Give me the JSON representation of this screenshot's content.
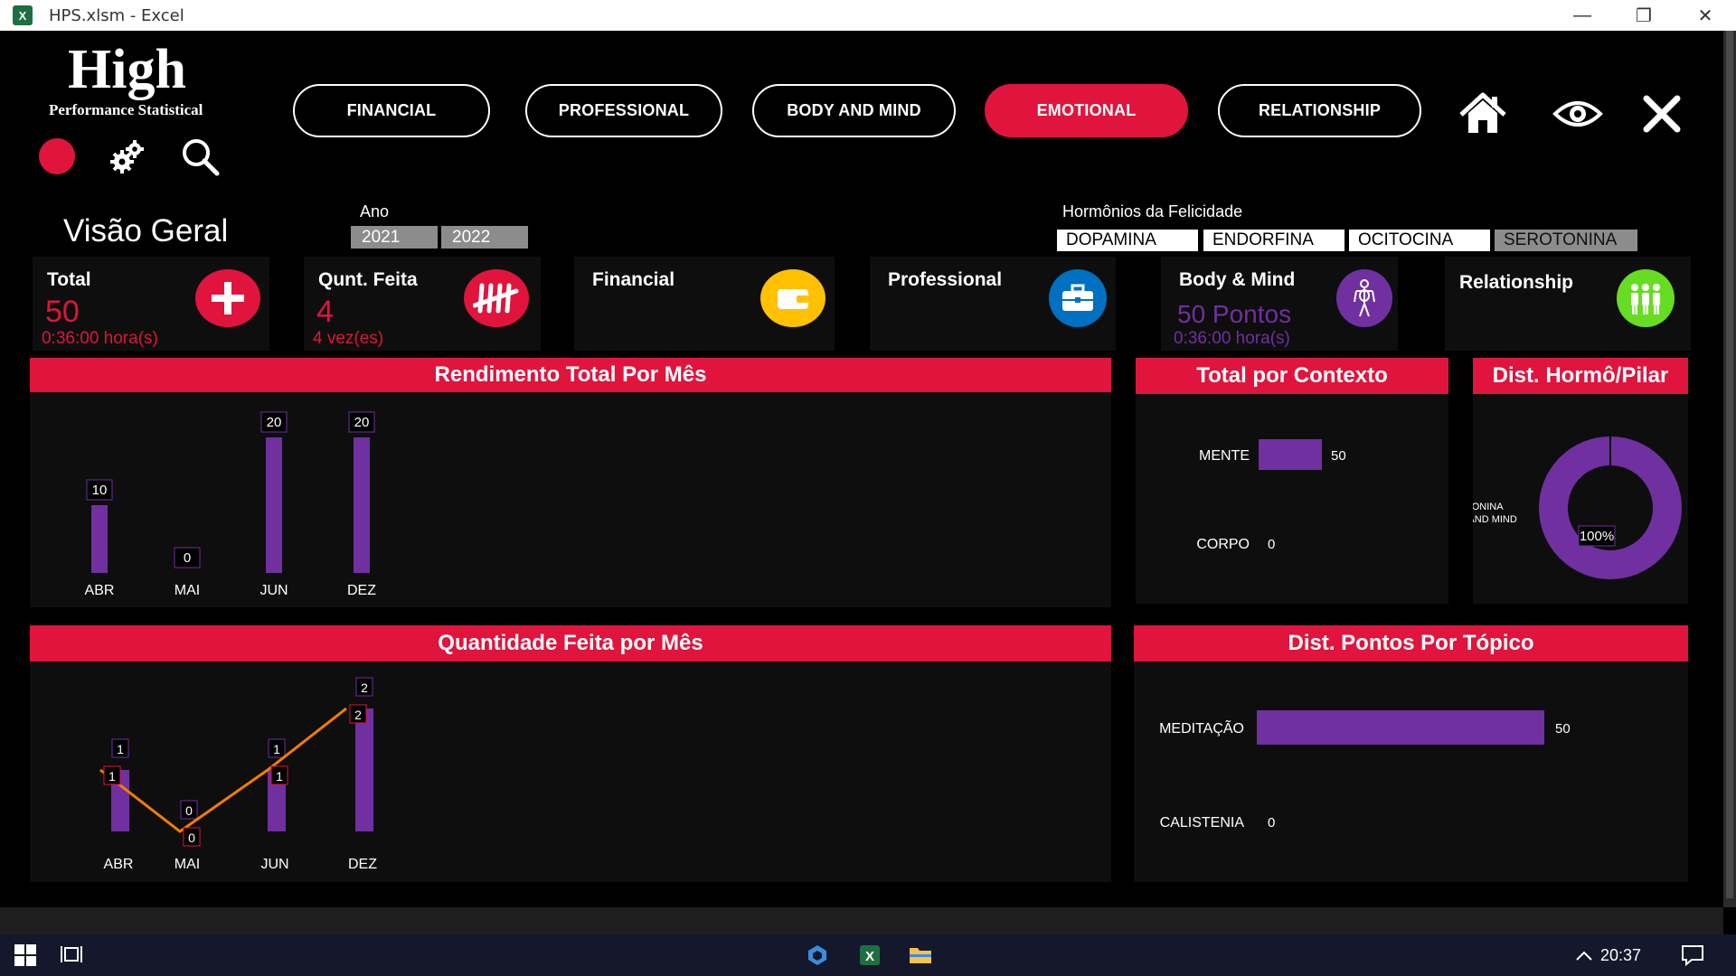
{
  "window": {
    "title": "HPS.xlsm  -  Excel",
    "app_icon_letter": "X"
  },
  "logo": {
    "title": "High",
    "subtitle": "Performance Statistical"
  },
  "nav": {
    "buttons": [
      {
        "label": "FINANCIAL",
        "active": false
      },
      {
        "label": "PROFESSIONAL",
        "active": false
      },
      {
        "label": "BODY AND MIND",
        "active": false
      },
      {
        "label": "EMOTIONAL",
        "active": true
      },
      {
        "label": "RELATIONSHIP",
        "active": false
      }
    ],
    "icons": [
      "home-icon",
      "eye-icon",
      "close-icon"
    ]
  },
  "tools": [
    "pie-chart-icon",
    "gears-icon",
    "search-icon"
  ],
  "overview": {
    "title": "Visão Geral",
    "ano_label": "Ano",
    "years": [
      "2021",
      "2022"
    ]
  },
  "hormones": {
    "label": "Hormônios da Felicidade",
    "items": [
      "DOPAMINA",
      "ENDORFINA",
      "OCITOCINA",
      "SEROTONINA"
    ],
    "selected": "SEROTONINA"
  },
  "kpis": {
    "total": {
      "label": "Total",
      "value": "50",
      "sub": "0:36:00 hora(s)"
    },
    "qunt": {
      "label": "Qunt. Feita",
      "value": "4",
      "sub": "4 vez(es)"
    },
    "financial": {
      "label": "Financial"
    },
    "professional": {
      "label": "Professional"
    },
    "body_mind": {
      "label": "Body & Mind",
      "value": "50 Pontos",
      "sub": "0:36:00 hora(s)"
    },
    "relationship": {
      "label": "Relationship"
    }
  },
  "colors": {
    "accent": "#e0143c",
    "purple": "#7030a0",
    "orange": "#f57c00",
    "panel": "#0e0e0e"
  },
  "panels": {
    "rendimento": "Rendimento Total Por Mês",
    "quantidade": "Quantidade Feita por Mês",
    "contexto": "Total por Contexto",
    "dist_hormo": "Dist. Hormô/Pilar",
    "dist_pontos": "Dist. Pontos Por Tópico"
  },
  "chart_data": [
    {
      "type": "bar",
      "title": "Rendimento Total Por Mês",
      "categories": [
        "ABR",
        "MAI",
        "JUN",
        "DEZ"
      ],
      "values": [
        10,
        0,
        20,
        20
      ],
      "ylim": [
        0,
        20
      ]
    },
    {
      "type": "bar",
      "title": "Quantidade Feita por Mês",
      "categories": [
        "ABR",
        "MAI",
        "JUN",
        "DEZ"
      ],
      "series": [
        {
          "kind": "bar",
          "values": [
            1,
            0,
            1,
            2
          ]
        },
        {
          "kind": "line",
          "values": [
            1,
            0,
            1,
            2
          ]
        }
      ],
      "ylim": [
        0,
        2
      ]
    },
    {
      "type": "bar",
      "title": "Total por Contexto",
      "orientation": "horizontal",
      "categories": [
        "MENTE",
        "CORPO"
      ],
      "values": [
        50,
        0
      ]
    },
    {
      "type": "pie",
      "title": "Dist. Hormô/Pilar",
      "legend": [
        "SEROTONINA",
        "BODY AND MIND"
      ],
      "values": [
        100
      ],
      "labels": [
        "100%"
      ]
    },
    {
      "type": "bar",
      "title": "Dist. Pontos Por Tópico",
      "orientation": "horizontal",
      "categories": [
        "MEDITAÇÃO",
        "CALISTENIA"
      ],
      "values": [
        50,
        0
      ]
    }
  ],
  "taskbar": {
    "time": "20:37"
  }
}
